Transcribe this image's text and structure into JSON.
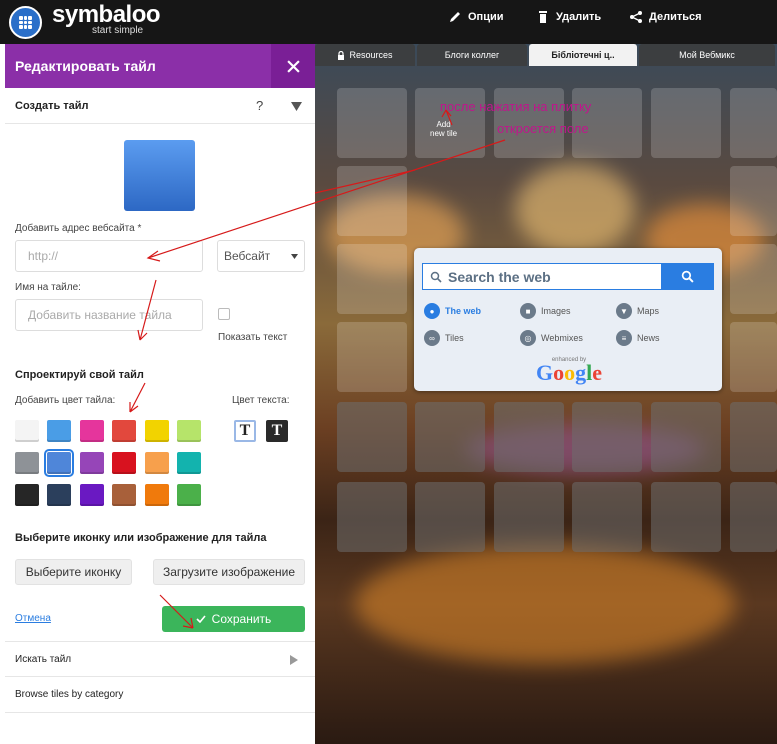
{
  "header": {
    "brand": "symbaloo",
    "tagline": "start simple",
    "actions": {
      "options": "Опции",
      "delete": "Удалить",
      "share": "Делиться"
    }
  },
  "tabs": [
    {
      "label": "Resources",
      "icon": "lock-icon"
    },
    {
      "label": "Блоги коллег"
    },
    {
      "label": "Бібліотечні ц..",
      "active": true
    },
    {
      "label": "Мой Вебмикс"
    }
  ],
  "grid": {
    "new_tile_label": "Add\nnew tile"
  },
  "search_widget": {
    "placeholder": "Search the web",
    "options": [
      {
        "label": "The web",
        "icon": "search-icon",
        "active": true
      },
      {
        "label": "Images",
        "icon": "camera-icon"
      },
      {
        "label": "Maps",
        "icon": "map-pin-icon"
      },
      {
        "label": "Tiles",
        "icon": "link-icon"
      },
      {
        "label": "Webmixes",
        "icon": "webmix-icon"
      },
      {
        "label": "News",
        "icon": "news-icon"
      }
    ],
    "enhanced_by": "enhanced by",
    "google": "Google"
  },
  "panel": {
    "title": "Редактировать тайл",
    "create_tile": "Создать тайл",
    "help": "?",
    "add_url_label": "Добавить адрес вебсайта *",
    "url_placeholder": "http://",
    "type_select": "Вебсайт",
    "name_label": "Имя на тайле:",
    "name_placeholder": "Добавить название тайла",
    "show_text": "Показать текст",
    "design_heading": "Спроектируй свой тайл",
    "add_color": "Добавить цвет тайла:",
    "text_color": "Цвет текста:",
    "text_color_glyph": "T",
    "colors": [
      "#f4f4f4",
      "#4a9de6",
      "#e5359c",
      "#e2483d",
      "#f2d300",
      "#b6e46a",
      "#8e9297",
      "#4f86d9",
      "#9645b8",
      "#d8121f",
      "#f7a04c",
      "#13b3ae",
      "#262626",
      "#2b3f5c",
      "#6a19c2",
      "#a8603a",
      "#f07a0c",
      "#4bb04a"
    ],
    "icon_heading": "Выберите иконку или изображение для тайла",
    "choose_icon": "Выберите иконку",
    "upload_image": "Загрузите изображение",
    "cancel": "Отмена",
    "save": "Сохранить",
    "search_tile": "Искать тайл",
    "browse": "Browse tiles by category"
  },
  "annotation": {
    "line1": "после нажатия на плитку",
    "line2": "откроется поле"
  },
  "colors": {
    "accent_purple": "#8b2fa8",
    "save_green": "#3bb55b",
    "link_blue": "#2a7de1",
    "annot_magenta": "#c0158c"
  }
}
